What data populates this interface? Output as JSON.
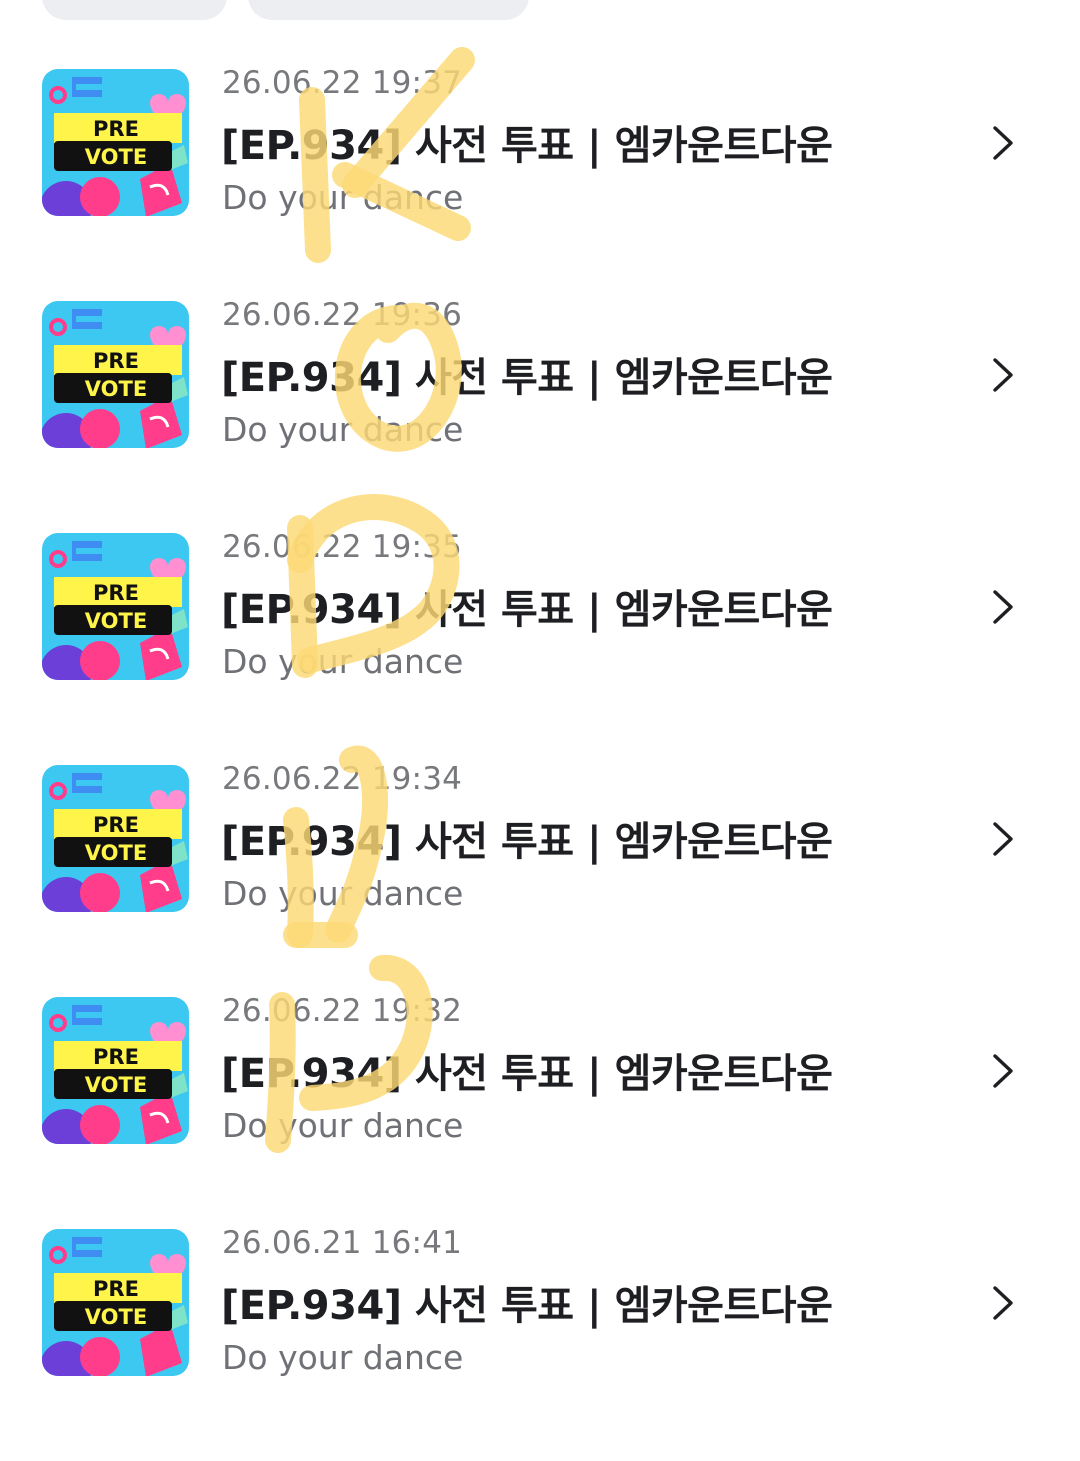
{
  "colors": {
    "title": "#1e1f22",
    "date": "#77797d",
    "subtitle": "#6f7176",
    "chevron": "#1e1f22",
    "tab_pill": "#eceef1",
    "highlighter": "#fcd975"
  },
  "thumbnail": {
    "line1": "PRE",
    "line2": "VOTE"
  },
  "items": [
    {
      "date": "26.06.22 19:37",
      "title": "[EP.934] 사전 투표 | 엠카운트다운",
      "subtitle": "Do your dance",
      "icon": "chevron-right-icon"
    },
    {
      "date": "26.06.22 19:36",
      "title": "[EP.934] 사전 투표 | 엠카운트다운",
      "subtitle": "Do your dance",
      "icon": "chevron-right-icon"
    },
    {
      "date": "26.06.22 19:35",
      "title": "[EP.934] 사전 투표 | 엠카운트다운",
      "subtitle": "Do your dance",
      "icon": "chevron-right-icon"
    },
    {
      "date": "26.06.22 19:34",
      "title": "[EP.934] 사전 투표 | 엠카운트다운",
      "subtitle": "Do your dance",
      "icon": "chevron-right-icon"
    },
    {
      "date": "26.06.22 19:32",
      "title": "[EP.934] 사전 투표 | 엠카운트다운",
      "subtitle": "Do your dance",
      "icon": "chevron-right-icon"
    },
    {
      "date": "26.06.21 16:41",
      "title": "[EP.934] 사전 투표 | 엠카운트다운",
      "subtitle": "Do your dance",
      "icon": "chevron-right-icon"
    }
  ]
}
